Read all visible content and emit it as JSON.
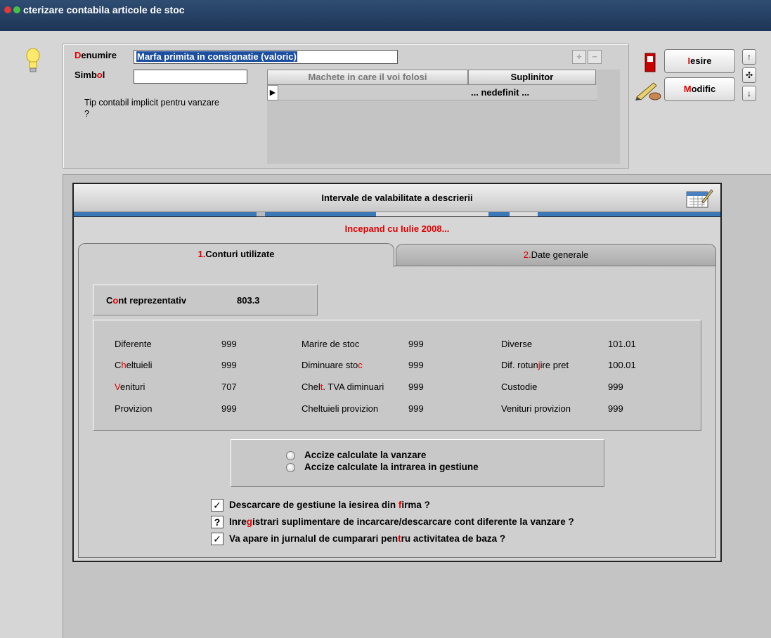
{
  "window": {
    "title": "cterizare contabila articole de stoc"
  },
  "header": {
    "denumire_label_first": "D",
    "denumire_label_rest": "enumire",
    "denumire_value": "Marfa primita in consignatie (valoric)",
    "simbol_label_first": "Simb",
    "simbol_label_accent": "o",
    "simbol_label_rest": "l",
    "simbol_value": "",
    "tip_contabil_label": "Tip contabil implicit pentru vanzare",
    "tip_contabil_value": "?"
  },
  "grid": {
    "col1": "Machete in care il voi folosi",
    "col2": "Suplinitor",
    "row1_col1": "",
    "row1_col2": "... nedefinit ...",
    "add_symbol": "+",
    "remove_symbol": "−"
  },
  "actions": {
    "iesire_accent": "I",
    "iesire_rest": "esire",
    "modific_accent": "M",
    "modific_rest": "odific"
  },
  "intervals": {
    "title": "Intervale de valabilitate a descrierii",
    "period": "Incepand cu Iulie 2008..."
  },
  "tabs": {
    "tab1_num": "1.",
    "tab1_label": "Conturi utilizate",
    "tab2_num": "2.",
    "tab2_label": "Date generale"
  },
  "cont_reprezentativ": {
    "label_first": "C",
    "label_accent": "o",
    "label_rest": "nt reprezentativ",
    "value": "803.3"
  },
  "accounts": {
    "diferente": {
      "label": "Diferente",
      "value": "999"
    },
    "cheltuieli": {
      "label_first": "C",
      "label_accent": "h",
      "label_rest": "eltuieli",
      "value": "999"
    },
    "venituri": {
      "label_first": "",
      "label_accent": "V",
      "label_rest": "enituri",
      "value": "707"
    },
    "provizion": {
      "label": "Provizion",
      "value": "999"
    },
    "marire_stoc": {
      "label": "Marire de stoc",
      "value": "999"
    },
    "diminuare_stoc": {
      "label_first": "Diminuare sto",
      "label_accent": "c",
      "value": "999"
    },
    "chelt_tva": {
      "label_first": "Chel",
      "label_accent": "t",
      "label_rest": ". TVA diminuari",
      "value": "999"
    },
    "cheltuieli_provizion": {
      "label": "Cheltuieli provizion",
      "value": "999"
    },
    "diverse": {
      "label": "Diverse",
      "value": "101.01"
    },
    "dif_rotunjire": {
      "label_first": "Dif. rotun",
      "label_accent": "j",
      "label_rest": "ire pret",
      "value": "100.01"
    },
    "custodie": {
      "label": "Custodie",
      "value": "999"
    },
    "venituri_provizion": {
      "label": "Venituri provizion",
      "value": "999"
    }
  },
  "accize": {
    "option1": "Accize calculate la vanzare",
    "option2": "Accize calculate la intrarea in gestiune"
  },
  "checks": {
    "c1_mark": "✓",
    "c1_first": "Descarcare de gestiune la iesirea din ",
    "c1_accent": "f",
    "c1_rest": "irma ?",
    "c2_mark": "?",
    "c2_first": "Inre",
    "c2_accent": "g",
    "c2_rest": "istrari suplimentare de incarcare/descarcare cont diferente la vanzare ?",
    "c3_mark": "✓",
    "c3_first": "Va apare in jurnalul de cumparari pen",
    "c3_accent": "t",
    "c3_rest": "ru activitatea de baza ?"
  }
}
